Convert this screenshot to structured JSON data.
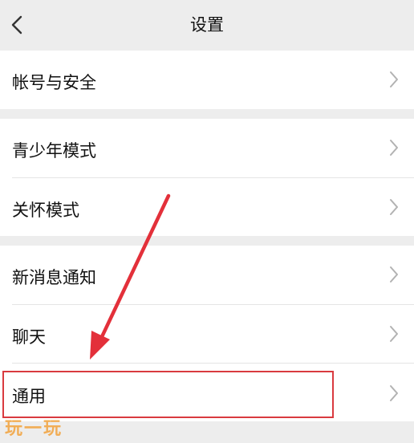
{
  "header": {
    "title": "设置",
    "back_icon": "back-arrow-icon"
  },
  "rows": [
    {
      "label": "帐号与安全"
    },
    {
      "label": "青少年模式"
    },
    {
      "label": "关怀模式"
    },
    {
      "label": "新消息通知"
    },
    {
      "label": "聊天"
    },
    {
      "label": "通用"
    }
  ],
  "annotation": {
    "arrow_color": "#e3303a",
    "highlight_color": "#d93a3f"
  },
  "watermark": "玩一玩",
  "colors": {
    "background": "#ededed",
    "row_background": "#ffffff",
    "text": "#111111",
    "chevron": "#b2b2b2"
  }
}
